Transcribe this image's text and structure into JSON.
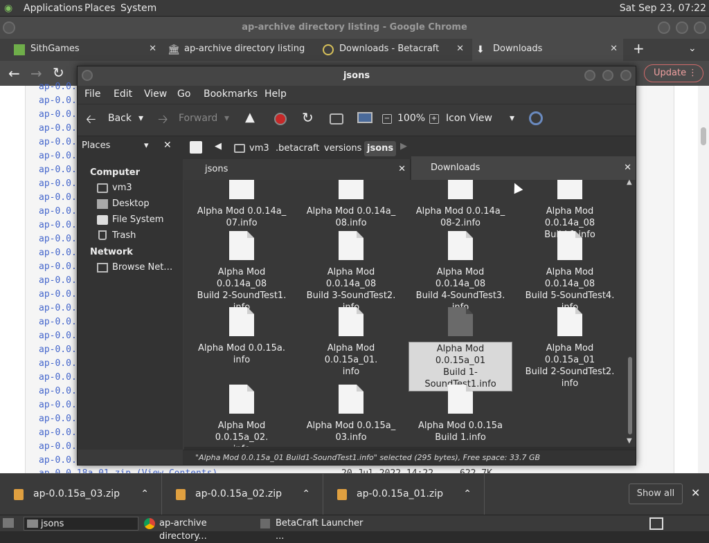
{
  "top_panel": {
    "menus": [
      "Applications",
      "Places",
      "System"
    ],
    "clock": "Sat Sep 23, 07:22"
  },
  "chrome": {
    "window_title": "ap-archive directory listing - Google Chrome",
    "tabs": [
      {
        "label": "SithGames"
      },
      {
        "label": "ap-archive directory listing"
      },
      {
        "label": "Downloads - Betacraft"
      },
      {
        "label": "Downloads"
      }
    ],
    "new_tab": "+",
    "update_label": "Update"
  },
  "webpage": {
    "link_prefix": "ap-0.0.",
    "bottom_row": {
      "name": "ap-0.0.18a_01.zip (View Contents)",
      "date": "20-Jul-2022 14:22",
      "size": "622.7K"
    }
  },
  "downloads_shelf": {
    "items": [
      "ap-0.0.15a_03.zip",
      "ap-0.0.15a_02.zip",
      "ap-0.0.15a_01.zip"
    ],
    "show_all": "Show all"
  },
  "taskbar": {
    "items": [
      "jsons",
      "ap-archive directory...",
      "BetaCraft Launcher ..."
    ]
  },
  "caja": {
    "title": "jsons",
    "menu": [
      "File",
      "Edit",
      "View",
      "Go",
      "Bookmarks",
      "Help"
    ],
    "toolbar": {
      "back": "Back",
      "forward": "Forward",
      "zoom": "100%",
      "view_mode": "Icon View"
    },
    "breadcrumbs": [
      "vm3",
      ".betacraft",
      "versions",
      "jsons"
    ],
    "sidebar": {
      "selector": "Places",
      "computer_heading": "Computer",
      "computer_items": [
        "vm3",
        "Desktop",
        "File System",
        "Trash"
      ],
      "network_heading": "Network",
      "network_items": [
        "Browse Net…"
      ]
    },
    "panes": [
      "jsons",
      "Downloads"
    ],
    "files": [
      [
        "Alpha Mod 0.0.14a_",
        "07.info"
      ],
      [
        "Alpha Mod 0.0.14a_",
        "08.info"
      ],
      [
        "Alpha Mod 0.0.14a_",
        "08-2.info"
      ],
      [
        "Alpha Mod 0.0.14a_08",
        "Build 1.info"
      ],
      [
        "Alpha Mod 0.0.14a_08",
        "Build 2-SoundTest1.",
        "info"
      ],
      [
        "Alpha Mod 0.0.14a_08",
        "Build 3-SoundTest2.",
        "info"
      ],
      [
        "Alpha Mod 0.0.14a_08",
        "Build 4-SoundTest3.",
        "info"
      ],
      [
        "Alpha Mod 0.0.14a_08",
        "Build 5-SoundTest4.",
        "info"
      ],
      [
        "Alpha Mod 0.0.15a.",
        "info"
      ],
      [
        "Alpha Mod 0.0.15a_01.",
        "info"
      ],
      [
        "Alpha Mod 0.0.15a_01",
        "Build 1-",
        "SoundTest1.info"
      ],
      [
        "Alpha Mod 0.0.15a_01",
        "Build 2-SoundTest2.",
        "info"
      ],
      [
        "Alpha Mod 0.0.15a_02.",
        "info"
      ],
      [
        "Alpha Mod 0.0.15a_",
        "03.info"
      ],
      [
        "Alpha Mod 0.0.15a",
        "Build 1.info"
      ]
    ],
    "selected_index": 10,
    "status": "\"Alpha Mod 0.0.15a_01 Build1-SoundTest1.info\" selected (295 bytes), Free space: 33.7 GB"
  },
  "colors": {
    "selection": "#d9d9d9",
    "update_border": "#d36b6b",
    "link": "#4466cc"
  }
}
